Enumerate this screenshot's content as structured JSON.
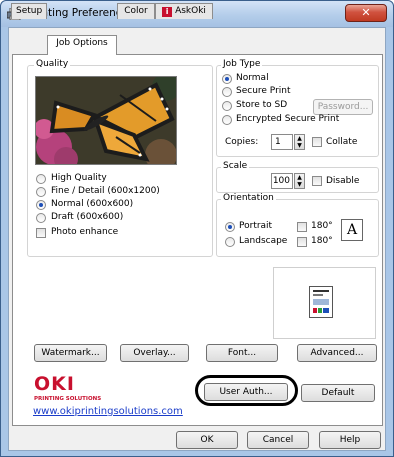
{
  "window": {
    "title": "Printing Preferences",
    "close_glyph": "✕"
  },
  "tabs": [
    {
      "label": "Setup"
    },
    {
      "label": "Job Options"
    },
    {
      "label": "Color"
    },
    {
      "label": "AskOki"
    }
  ],
  "quality": {
    "legend": "Quality",
    "options": [
      {
        "label": "High Quality",
        "selected": false
      },
      {
        "label": "Fine / Detail (600x1200)",
        "selected": false
      },
      {
        "label": "Normal (600x600)",
        "selected": true
      },
      {
        "label": "Draft (600x600)",
        "selected": false
      }
    ],
    "photo_enhance": {
      "label": "Photo enhance",
      "checked": false
    }
  },
  "job_type": {
    "legend": "Job Type",
    "options": [
      {
        "label": "Normal",
        "selected": true
      },
      {
        "label": "Secure Print",
        "selected": false
      },
      {
        "label": "Store to SD",
        "selected": false
      },
      {
        "label": "Encrypted Secure Print",
        "selected": false
      }
    ],
    "password_button": "Password...",
    "copies_label": "Copies:",
    "copies_value": "1",
    "collate": {
      "label": "Collate",
      "checked": false
    }
  },
  "scale": {
    "legend": "Scale",
    "value": "100",
    "disable": {
      "label": "Disable",
      "checked": false
    }
  },
  "orientation": {
    "legend": "Orientation",
    "portrait": {
      "label": "Portrait",
      "selected": true
    },
    "landscape": {
      "label": "Landscape",
      "selected": false
    },
    "rotate_portrait": {
      "label": "180°",
      "checked": false
    },
    "rotate_landscape": {
      "label": "180°",
      "checked": false
    },
    "preview_letter": "A"
  },
  "buttons": {
    "watermark": "Watermark...",
    "overlay": "Overlay...",
    "font": "Font...",
    "advanced": "Advanced...",
    "user_auth": "User Auth...",
    "default": "Default",
    "ok": "OK",
    "cancel": "Cancel",
    "help": "Help"
  },
  "brand": {
    "logo": "OKI",
    "tagline": "PRINTING SOLUTIONS",
    "url": "www.okiprintingsolutions.com",
    "red": "#c8102e"
  },
  "colors": {
    "accent_radio": "#1d4fb8",
    "close": "#c03a22"
  }
}
